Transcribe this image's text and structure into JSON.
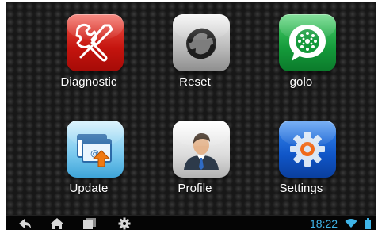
{
  "apps": [
    {
      "label": "Diagnostic",
      "icon": "wrench-icon"
    },
    {
      "label": "Reset",
      "icon": "reset-icon"
    },
    {
      "label": "golo",
      "icon": "golo-icon"
    },
    {
      "label": "Update",
      "icon": "update-icon"
    },
    {
      "label": "Profile",
      "icon": "profile-icon"
    },
    {
      "label": "Settings",
      "icon": "settings-gear-icon"
    }
  ],
  "navbar": {
    "buttons": [
      "back-icon",
      "home-icon",
      "recent-apps-icon",
      "settings-icon"
    ],
    "time": "18:22"
  },
  "colors": {
    "clock": "#3fb5e8",
    "diagnostic": "#d6201a",
    "golo": "#149a3a",
    "settings": "#1056c8"
  }
}
